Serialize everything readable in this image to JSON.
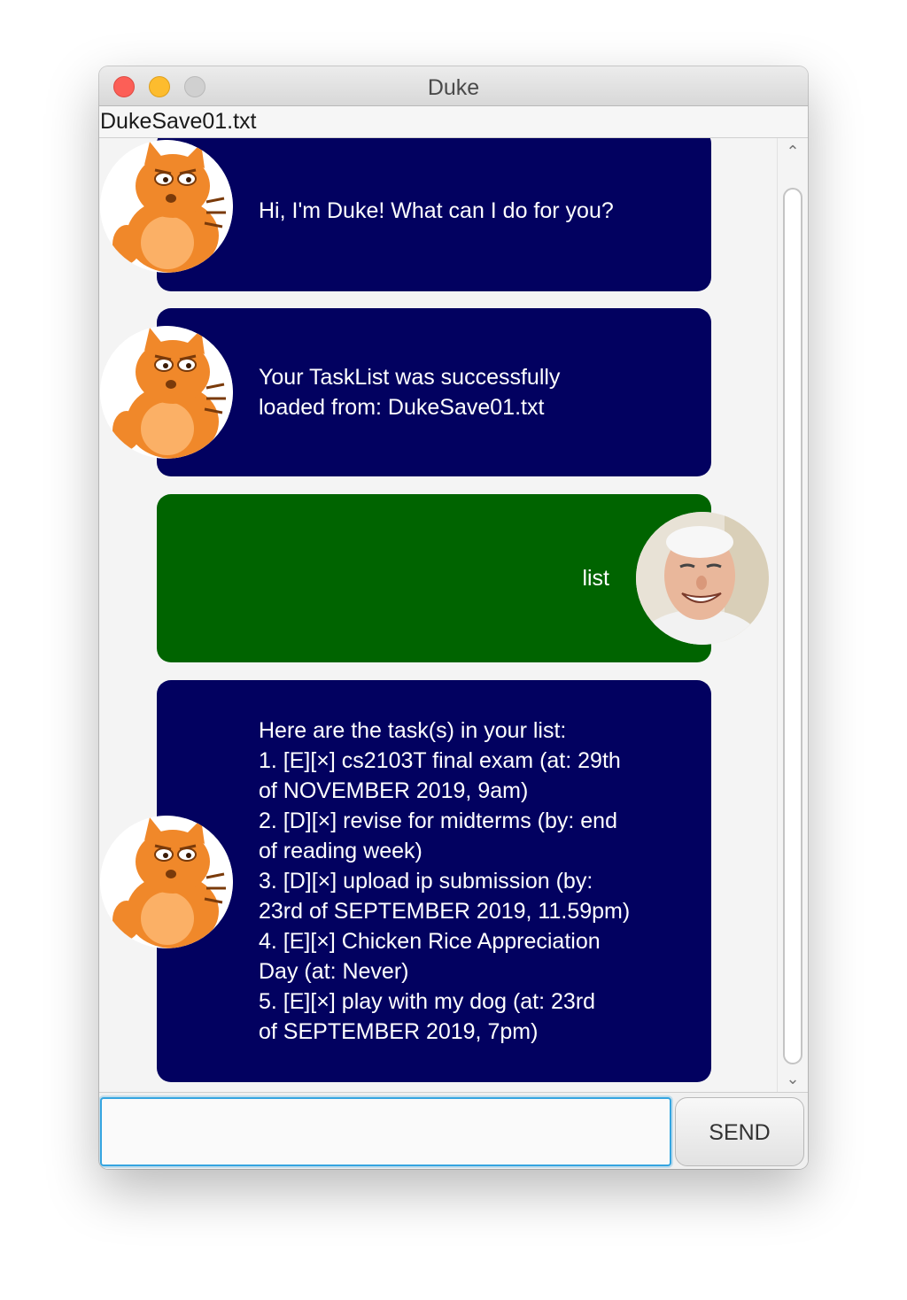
{
  "window": {
    "title": "Duke",
    "file_label": "DukeSave01.txt"
  },
  "messages": [
    {
      "sender": "duke",
      "avatar": "orange-cat-avatar",
      "text": "Hi, I'm Duke! What can I do for you?"
    },
    {
      "sender": "duke",
      "avatar": "orange-cat-avatar",
      "text": "Your TaskList was successfully\nloaded from: DukeSave01.txt"
    },
    {
      "sender": "user",
      "avatar": "old-man-avatar",
      "text": "list"
    },
    {
      "sender": "duke",
      "avatar": "orange-cat-avatar",
      "text": "Here are the task(s) in your list:\n1. [E][×] cs2103T final exam (at: 29th\nof NOVEMBER 2019, 9am)\n2. [D][×] revise for midterms (by: end\nof reading week)\n3. [D][×] upload ip submission (by:\n23rd of SEPTEMBER 2019, 11.59pm)\n4. [E][×] Chicken Rice Appreciation\nDay (at: Never)\n5. [E][×] play with my dog (at: 23rd\nof SEPTEMBER 2019, 7pm)"
    }
  ],
  "input": {
    "value": "",
    "placeholder": ""
  },
  "send_button": {
    "label": "SEND"
  },
  "colors": {
    "duke_bubble": "#020160",
    "user_bubble": "#006400",
    "input_focus": "#35a5e0"
  }
}
